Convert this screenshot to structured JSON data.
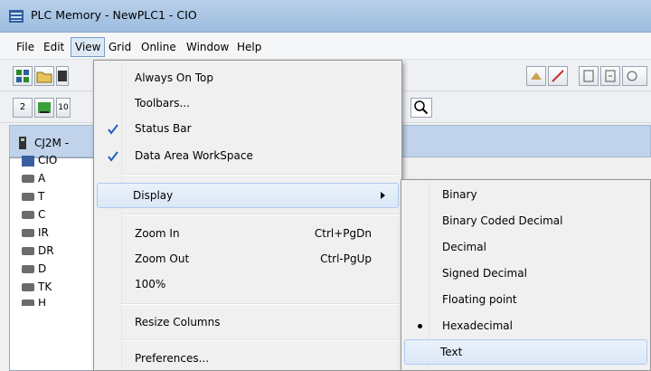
{
  "window": {
    "title": "PLC Memory - NewPLC1 - CIO"
  },
  "menubar": [
    "File",
    "Edit",
    "View",
    "Grid",
    "Online",
    "Window",
    "Help"
  ],
  "toolbar2": {
    "btn1": "2",
    "btn3": "10"
  },
  "tree": {
    "root": "CJ2M -",
    "items": [
      "CIO",
      "A",
      "T",
      "C",
      "IR",
      "DR",
      "D",
      "TK",
      "H"
    ]
  },
  "view_menu": {
    "always_on_top": "Always On Top",
    "toolbars": "Toolbars...",
    "status_bar": "Status Bar",
    "data_area_workspace": "Data Area WorkSpace",
    "display": "Display",
    "zoom_in": "Zoom In",
    "zoom_in_shortcut": "Ctrl+PgDn",
    "zoom_out": "Zoom Out",
    "zoom_out_shortcut": "Ctrl-PgUp",
    "zoom_100": "100%",
    "resize_columns": "Resize Columns",
    "preferences": "Preferences..."
  },
  "display_menu": {
    "binary": "Binary",
    "bcd": "Binary Coded Decimal",
    "decimal": "Decimal",
    "signed_decimal": "Signed Decimal",
    "floating_point": "Floating point",
    "hexadecimal": "Hexadecimal",
    "text": "Text"
  },
  "colors": {
    "check": "#1f5fbf",
    "highlight": "#dbe8f7",
    "titlebar": "#a7c4e3"
  },
  "icons": [
    "app-icon",
    "folder-open-icon",
    "save-icon",
    "search-icon",
    "plc-icon",
    "memory-chip-icon",
    "check-icon",
    "submenu-arrow-icon",
    "radio-dot-icon"
  ]
}
